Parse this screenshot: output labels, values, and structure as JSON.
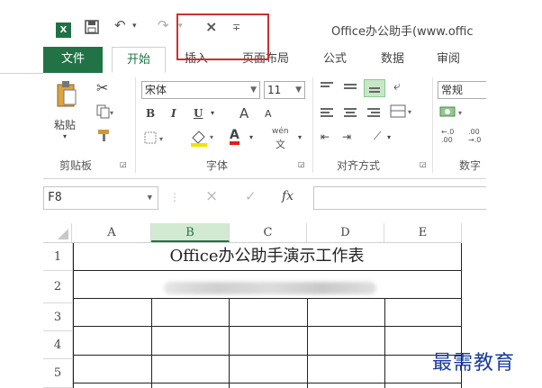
{
  "titlebar": {
    "app_icon": "excel-logo-icon",
    "app_icon_letter": "X",
    "undo_glyph": "↶",
    "redo_glyph": "↷",
    "close_glyph": "×",
    "customize_glyph": "∓",
    "title": "Office办公助手(www.offic"
  },
  "tabs": [
    "文件",
    "开始",
    "插入",
    "页面布局",
    "公式",
    "数据",
    "审阅"
  ],
  "ribbon": {
    "clipboard": {
      "paste_label": "粘贴",
      "group_label": "剪贴板"
    },
    "font": {
      "font_name": "宋体",
      "font_size": "11",
      "bold": "B",
      "italic": "I",
      "underline": "U",
      "grow": "A",
      "shrink": "A",
      "font_color": "A",
      "phonetic_top": "wén",
      "phonetic_bottom": "文",
      "group_label": "字体"
    },
    "alignment": {
      "group_label": "对齐方式"
    },
    "number": {
      "format": "常规",
      "decimal_inc": "←.0\n.00",
      "decimal_dec": ".00\n→.0",
      "group_label": "数字"
    }
  },
  "formula_bar": {
    "name_box": "F8",
    "cancel_glyph": "×",
    "enter_glyph": "✓",
    "fx_label": "fx",
    "value": ""
  },
  "sheet": {
    "columns": [
      "A",
      "B",
      "C",
      "D",
      "E"
    ],
    "rows": [
      "1",
      "2",
      "3",
      "4",
      "5"
    ],
    "title_cell": "Office办公助手演示工作表"
  },
  "watermark": "最需教育",
  "colors": {
    "excel_green": "#217346",
    "highlight_red": "#c8322f",
    "watermark_blue": "#1a3b9c"
  }
}
